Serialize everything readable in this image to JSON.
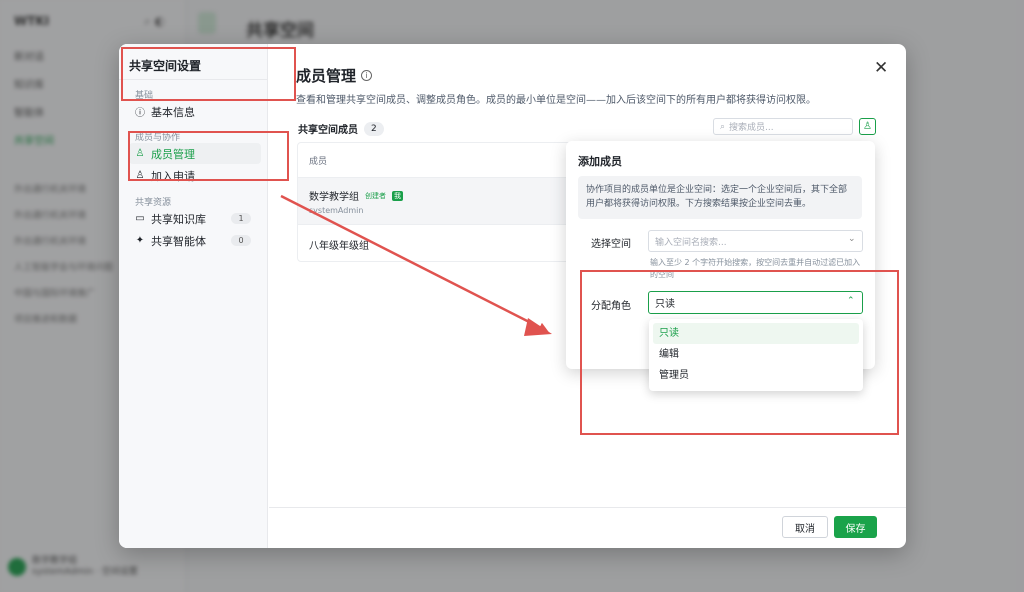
{
  "background": {
    "brand": "WTKI",
    "main_title": "共享空间",
    "nav_items": [
      "新对话",
      "知识库",
      "智能体",
      "共享空间"
    ],
    "recent_items": [
      "外出通行机关环境",
      "外出通行机关环境",
      "外出通行机关环境",
      "人工智能学会与环境问题",
      "中国与国际环境推广",
      "项目推进和数据"
    ],
    "user_name": "数学教学组",
    "user_sub": "systemAdmin · 空间设置"
  },
  "modal": {
    "side_title": "共享空间设置",
    "groups": {
      "basic": "基础",
      "members": "成员与协作",
      "resources": "共享资源"
    },
    "items": {
      "basic_info": "基本信息",
      "member_mgmt": "成员管理",
      "join_requests": "加入申请",
      "knowledge": "共享知识库",
      "knowledge_count": "1",
      "agents": "共享智能体",
      "agents_count": "0"
    },
    "title": "成员管理",
    "description": "查看和管理共享空间成员、调整成员角色。成员的最小单位是空间——加入后该空间下的所有用户都将获得访问权限。",
    "members_heading": "共享空间成员",
    "members_count": "2",
    "search_placeholder": "搜索成员...",
    "table": {
      "header": "成员",
      "rows": [
        {
          "name": "数学教学组",
          "creator_tag": "创建者",
          "me_tag": "我",
          "sub": "systemAdmin"
        },
        {
          "name": "八年级年级组"
        }
      ]
    },
    "cancel_label": "取消",
    "save_label": "保存"
  },
  "popover": {
    "title": "添加成员",
    "hint": "协作项目的成员单位是企业空间：选定一个企业空间后，其下全部用户都将获得访问权限。下方搜索结果按企业空间去重。",
    "space_label": "选择空间",
    "space_placeholder": "输入空间名搜索...",
    "space_help": "输入至少 2 个字符开始搜索，按空间去重并自动过滤已加入的空间",
    "role_label": "分配角色",
    "role_value": "只读",
    "role_options": [
      "只读",
      "编辑",
      "管理员"
    ]
  },
  "colors": {
    "accent": "#1a9f4a",
    "annotation": "#e0534f"
  }
}
